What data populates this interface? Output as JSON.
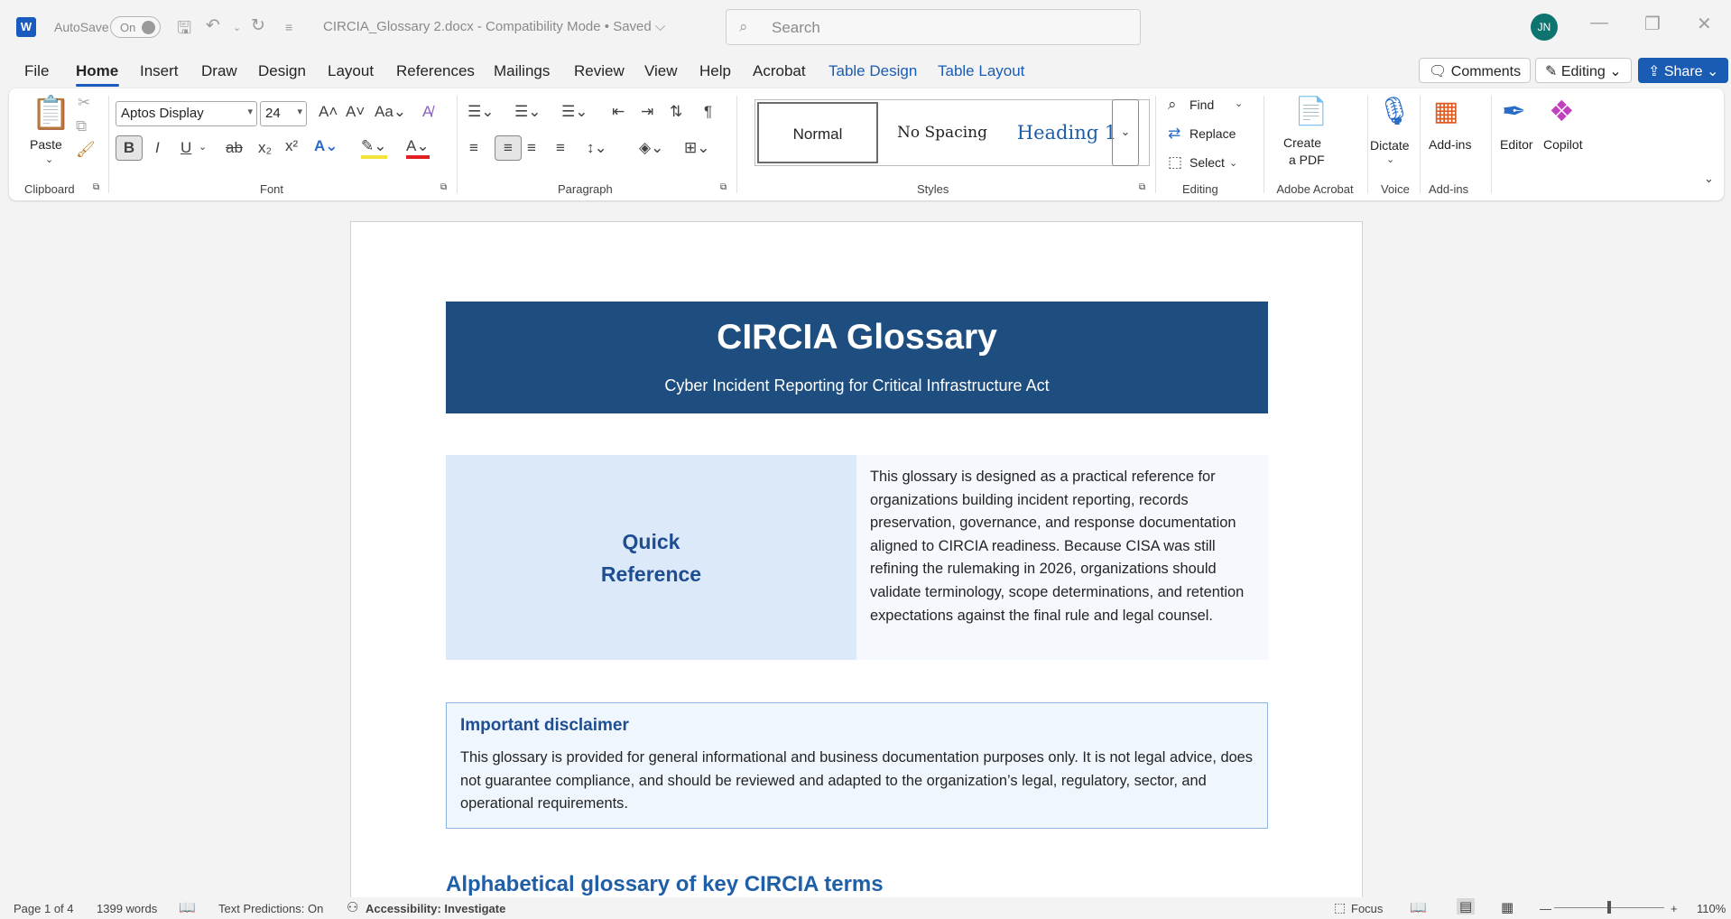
{
  "titlebar": {
    "autosave_label": "AutoSave",
    "autosave_state": "On",
    "document_title": "CIRCIA_Glossary 2.docx  -  Compatibility Mode  •  Saved ⌵",
    "search_placeholder": "Search",
    "user_initials": "JN"
  },
  "menu": {
    "tabs": [
      "File",
      "Home",
      "Insert",
      "Draw",
      "Design",
      "Layout",
      "References",
      "Mailings",
      "Review",
      "View",
      "Help",
      "Acrobat",
      "Table Design",
      "Table Layout"
    ],
    "comments": "Comments",
    "editing": "Editing",
    "share": "Share"
  },
  "ribbon": {
    "clipboard": {
      "paste": "Paste",
      "group": "Clipboard"
    },
    "font": {
      "name": "Aptos Display",
      "size": "24",
      "group": "Font"
    },
    "paragraph": {
      "group": "Paragraph"
    },
    "styles": {
      "items": [
        "Normal",
        "No Spacing",
        "Heading 1"
      ],
      "group": "Styles"
    },
    "editing": {
      "find": "Find",
      "replace": "Replace",
      "select": "Select",
      "group": "Editing"
    },
    "acrobat": {
      "create_pdf_1": "Create",
      "create_pdf_2": "a PDF",
      "group": "Adobe Acrobat"
    },
    "voice": {
      "dictate": "Dictate",
      "group": "Voice"
    },
    "addins": {
      "addins": "Add-ins",
      "group": "Add-ins"
    },
    "editor": "Editor",
    "copilot": "Copilot"
  },
  "document": {
    "header_title": "CIRCIA Glossary",
    "header_subtitle": "Cyber Incident Reporting for Critical Infrastructure Act",
    "quick_ref_line1": "Quick",
    "quick_ref_line2": "Reference",
    "quick_ref_text": "This glossary is designed as a practical reference for organizations building incident reporting, records preservation, governance, and response documentation aligned to CIRCIA readiness. Because CISA was still refining the rulemaking in 2026, organizations should validate terminology, scope determinations, and retention expectations against the final rule and legal counsel.",
    "disclaimer_title": "Important disclaimer",
    "disclaimer_text": "This glossary is provided for general informational and business documentation purposes only. It is not legal advice, does not guarantee compliance, and should be reviewed and adapted to the organization’s legal, regulatory, sector, and operational requirements.",
    "section_heading": "Alphabetical glossary of key CIRCIA terms"
  },
  "status": {
    "page": "Page 1 of 4",
    "words": "1399 words",
    "predictions": "Text Predictions: On",
    "accessibility": "Accessibility: Investigate",
    "focus": "Focus",
    "zoom": "110%"
  },
  "colors": {
    "accent": "#185abd",
    "header_bg": "#1e4d7f",
    "quick_ref_bg": "#dce9f8",
    "heading": "#1f5fa8"
  }
}
